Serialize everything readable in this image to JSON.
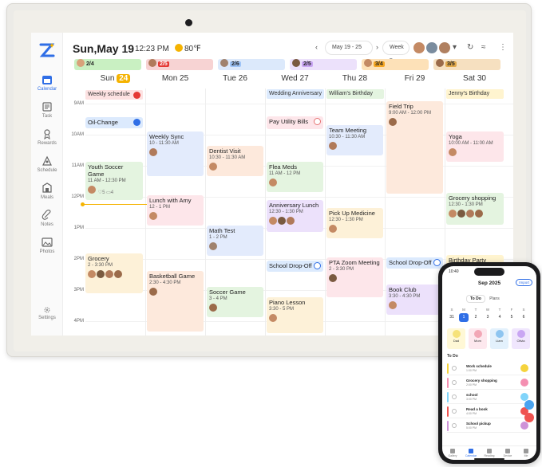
{
  "header": {
    "date": "Sun,May 19",
    "time": "12:23 PM",
    "weather": "80℉",
    "range": "May 19 - 25",
    "view": "Week"
  },
  "sidebar": [
    {
      "label": "Calendar",
      "icon": "calendar-icon",
      "active": true
    },
    {
      "label": "Task",
      "icon": "task-icon"
    },
    {
      "label": "Rewards",
      "icon": "rewards-icon"
    },
    {
      "label": "Schedule",
      "icon": "schedule-icon"
    },
    {
      "label": "Meals",
      "icon": "meals-icon"
    },
    {
      "label": "Notes",
      "icon": "notes-icon"
    },
    {
      "label": "Photos",
      "icon": "photos-icon"
    },
    {
      "label": "Settings",
      "icon": "settings-icon"
    }
  ],
  "members": [
    {
      "progress": "2/4",
      "color": "#c9f0c2",
      "avatar": "#d8a27a"
    },
    {
      "progress": "2/5",
      "color": "#e53935",
      "avatar": "#b07a5a"
    },
    {
      "progress": "2/6",
      "color": "#9ec4f7",
      "avatar": "#a0826d"
    },
    {
      "progress": "2/5",
      "color": "#c9a6f3",
      "avatar": "#7a5a40"
    },
    {
      "progress": "3/4",
      "color": "#f5a623",
      "avatar": "#c48a64"
    },
    {
      "progress": "3/5",
      "color": "#e0a84c",
      "avatar": "#9b6b4a"
    }
  ],
  "days": [
    {
      "name": "Sun",
      "num": "24",
      "today": true
    },
    {
      "name": "Mon",
      "num": "25"
    },
    {
      "name": "Tue",
      "num": "26"
    },
    {
      "name": "Wed",
      "num": "27"
    },
    {
      "name": "Thu",
      "num": "28"
    },
    {
      "name": "Fri",
      "num": "29"
    },
    {
      "name": "Sat",
      "num": "30"
    }
  ],
  "times": [
    "9AM",
    "10AM",
    "11AM",
    "12PM",
    "1PM",
    "2PM",
    "3PM",
    "4PM"
  ],
  "allday": {
    "weekly": "Weekly schedule",
    "wedding": "Wedding Anniversary",
    "williams": "William's Birthday",
    "jenny": "Jenny's Birthday"
  },
  "events": {
    "oil": {
      "title": "Oil-Change"
    },
    "youth": {
      "title": "Youth Soccer Game",
      "time": "11 AM - 12:30 PM",
      "likes": "5",
      "comments": "4"
    },
    "grocery_sun": {
      "title": "Grocery",
      "time": "2 - 3:30 PM"
    },
    "weekly_sync": {
      "title": "Weekly Sync",
      "time": "10 - 11:30 AM"
    },
    "lunch_amy": {
      "title": "Lunch with Amy",
      "time": "12 - 1 PM"
    },
    "basketball": {
      "title": "Basketball Game",
      "time": "2:30 - 4:30 PM"
    },
    "dentist": {
      "title": "Dentist Visit",
      "time": "10:30 - 11:30 AM"
    },
    "math": {
      "title": "Math Test",
      "time": "1 - 2 PM"
    },
    "soccer": {
      "title": "Soccer Game",
      "time": "3 - 4 PM"
    },
    "utility": {
      "title": "Pay Utility Bills"
    },
    "flea": {
      "title": "Flea Meds",
      "time": "11 AM - 12 PM"
    },
    "anniv_lunch": {
      "title": "Anniversary Lunch",
      "time": "12:30 - 1:30 PM"
    },
    "school_wed": {
      "title": "School Drop-Off"
    },
    "piano": {
      "title": "Piano Lesson",
      "time": "3:30 - 5 PM"
    },
    "team": {
      "title": "Team Meeting",
      "time": "10:30 - 11:30 AM"
    },
    "pickup": {
      "title": "Pick Up Medicine",
      "time": "12:30 - 1:30 PM"
    },
    "pta": {
      "title": "PTA Zoom Meeting",
      "time": "2 - 3:30 PM"
    },
    "field": {
      "title": "Field Trip",
      "time": "9:00 AM - 12:00 PM"
    },
    "school_fri": {
      "title": "School Drop-Off"
    },
    "book": {
      "title": "Book Club",
      "time": "3:30 - 4:30 PM"
    },
    "yoga": {
      "title": "Yoga",
      "time": "10:00 AM - 11:00 AM"
    },
    "grocery_sat": {
      "title": "Grocery shopping",
      "time": "12:30 - 1:30 PM"
    },
    "birthday_party": {
      "title": "Birthday Party"
    }
  },
  "phone": {
    "time": "10:40",
    "title": "Sep 2025",
    "import": "Import",
    "tabs": [
      "To Do",
      "Plans"
    ],
    "weekdays": [
      "S",
      "M",
      "T",
      "W",
      "T",
      "F",
      "S"
    ],
    "dates": [
      "31",
      "1",
      "2",
      "3",
      "4",
      "5",
      "6"
    ],
    "members": [
      {
        "name": "Dad",
        "color": "#f6e27a",
        "bg": "#fff8d6"
      },
      {
        "name": "Mom",
        "color": "#f2a7b6",
        "bg": "#fde8ee"
      },
      {
        "name": "Liam",
        "color": "#8ec5f0",
        "bg": "#e3f1fc"
      },
      {
        "name": "Olivia",
        "color": "#c9a6f3",
        "bg": "#f0e6fd"
      }
    ],
    "todo_header": "To Do",
    "todos": [
      {
        "title": "Work schedule",
        "sub": "1:00 PM",
        "color": "#f5d33d"
      },
      {
        "title": "Grocery shopping",
        "sub": "2:00 PM",
        "color": "#f48fb1"
      },
      {
        "title": "school",
        "sub": "3:00 PM",
        "color": "#81d4fa"
      },
      {
        "title": "Read a book",
        "sub": "4:00 PM",
        "color": "#ef5350"
      },
      {
        "title": "School pickup",
        "sub": "5:00 PM",
        "color": "#ce93d8"
      }
    ],
    "nav": [
      "Gallery",
      "Calendar",
      "Reading",
      "Device",
      "Me"
    ]
  }
}
